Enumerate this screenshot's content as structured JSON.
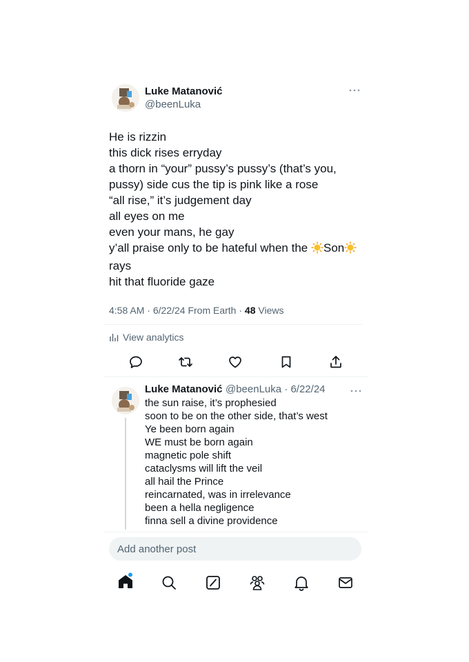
{
  "post": {
    "author_name": "Luke Matanović",
    "author_handle": "@beenLuka",
    "lines": [
      "He is rizzin",
      "this dick rises erryday",
      "a thorn in “your” pussy’s pussy’s (that’s you,",
      "pussy) side cus the tip is pink like a rose",
      "“all rise,” it’s judgement day",
      "all eyes on me",
      "even your mans, he gay",
      "y’all praise only to be hateful when the",
      "rays",
      "hit that fluoride gaze"
    ],
    "son_word": "Son",
    "time": "4:58 AM",
    "date": "6/22/24",
    "source": "From Earth",
    "views_count": "48",
    "views_label": "Views",
    "analytics_label": "View analytics"
  },
  "reply": {
    "author_name": "Luke Matanović",
    "author_handle": "@beenLuka",
    "date": "6/22/24",
    "lines": [
      "the sun raise, it’s prophesied",
      "soon to be on the other side, that’s west",
      "Ye been born again",
      "WE must be born again",
      "magnetic pole shift",
      "cataclysms will lift the veil",
      "all hail the Prince",
      "reincarnated, was in irrelevance",
      "been a hella negligence",
      "finna sell a divine providence"
    ]
  },
  "compose": {
    "placeholder": "Add another post"
  },
  "colors": {
    "text": "#0f1419",
    "secondary": "#536471",
    "accent": "#1d9bf0"
  },
  "icons": {
    "action_bar": [
      "reply-icon",
      "repost-icon",
      "like-icon",
      "bookmark-icon",
      "share-icon"
    ],
    "bottom_nav": [
      "home-icon",
      "search-icon",
      "grok-icon",
      "communities-icon",
      "notifications-icon",
      "messages-icon"
    ]
  }
}
